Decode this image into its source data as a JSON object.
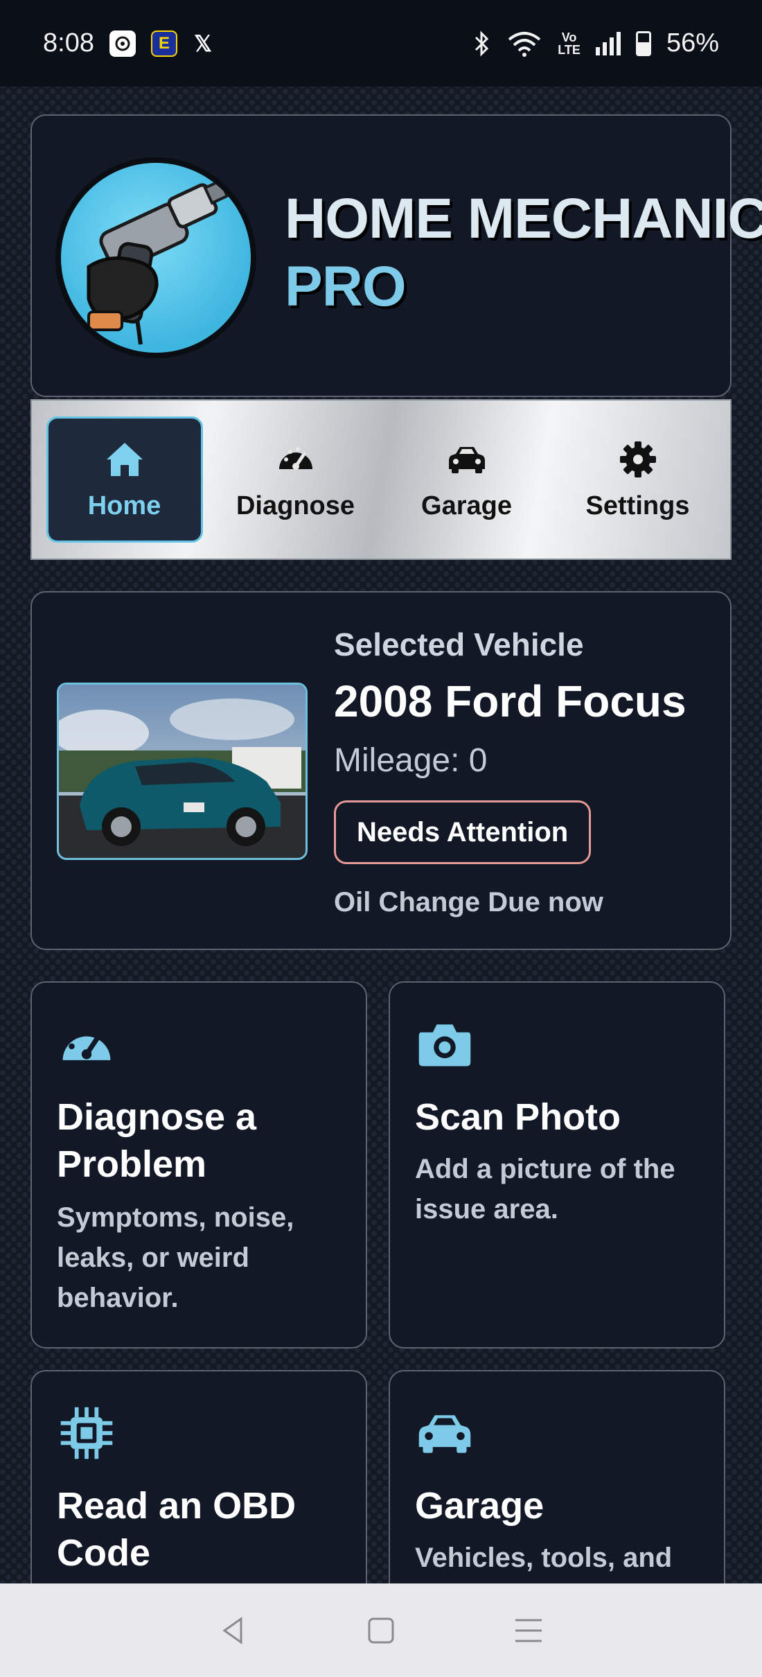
{
  "status_bar": {
    "time": "8:08",
    "apps": [
      "chatgpt-icon",
      "e-app-icon",
      "x-icon"
    ],
    "x_glyph": "𝕏",
    "volte": "Vo\nLTE",
    "battery_percent": "56%",
    "battery_level": 0.56
  },
  "header": {
    "title_line1": "HOME MECHANIC",
    "title_line2": "PRO"
  },
  "nav": {
    "items": [
      {
        "label": "Home",
        "icon": "home-icon",
        "active": true
      },
      {
        "label": "Diagnose",
        "icon": "gauge-icon",
        "active": false
      },
      {
        "label": "Garage",
        "icon": "car-icon",
        "active": false
      },
      {
        "label": "Settings",
        "icon": "gear-icon",
        "active": false
      }
    ]
  },
  "vehicle": {
    "section_label": "Selected Vehicle",
    "name": "2008 Ford Focus",
    "mileage": "Mileage: 0",
    "status_badge": "Needs Attention",
    "notice": "Oil Change Due now"
  },
  "tiles": [
    {
      "title": "Diagnose a Problem",
      "description": "Symptoms, noise, leaks, or weird behavior.",
      "icon": "gauge-icon"
    },
    {
      "title": "Scan Photo",
      "description": "Add a picture of the issue area.",
      "icon": "camera-icon"
    },
    {
      "title": "Read an OBD Code",
      "description": "",
      "icon": "chip-icon"
    },
    {
      "title": "Garage",
      "description": "Vehicles, tools, and",
      "icon": "car-icon"
    }
  ],
  "colors": {
    "accent": "#7dcbe8",
    "background": "#121826",
    "attention_border": "#e79a95"
  }
}
